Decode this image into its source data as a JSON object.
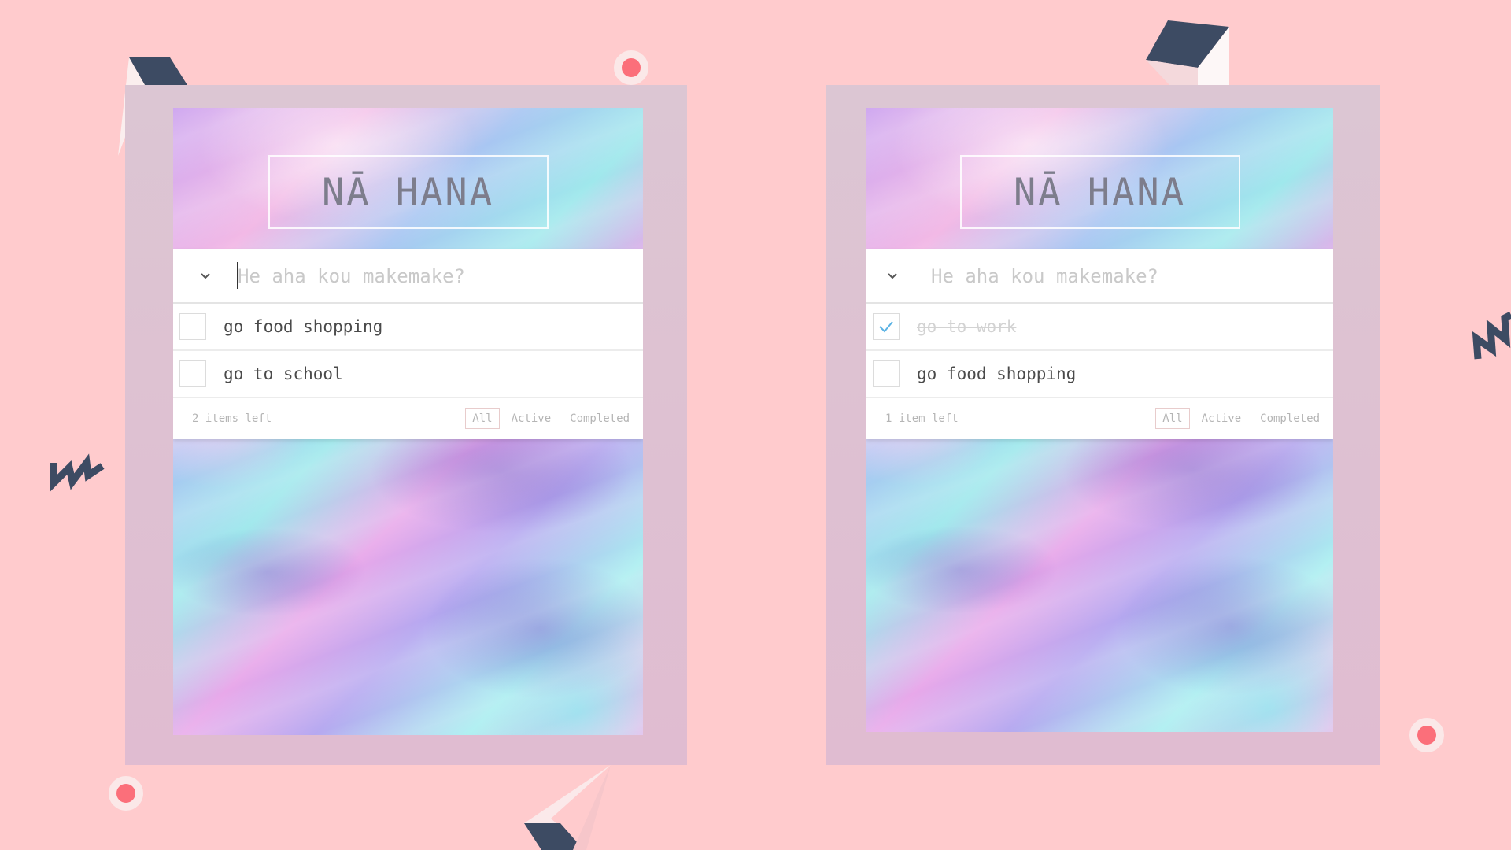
{
  "background_color": "#ffcbcd",
  "accent_dark": "#3d4b63",
  "apps": [
    {
      "title": "NĀ HANA",
      "input": {
        "placeholder": "He aha kou makemake?",
        "value": ""
      },
      "todos": [
        {
          "label": "go food shopping",
          "completed": false
        },
        {
          "label": "go to school",
          "completed": false
        }
      ],
      "footer": {
        "items_left": "2 items left",
        "filters": [
          "All",
          "Active",
          "Completed"
        ],
        "selected_filter": "All"
      }
    },
    {
      "title": "NĀ HANA",
      "input": {
        "placeholder": "He aha kou makemake?",
        "value": ""
      },
      "todos": [
        {
          "label": "go to work",
          "completed": true
        },
        {
          "label": "go food shopping",
          "completed": false
        }
      ],
      "footer": {
        "items_left": "1 item left",
        "filters": [
          "All",
          "Active",
          "Completed"
        ],
        "selected_filter": "All"
      }
    }
  ]
}
